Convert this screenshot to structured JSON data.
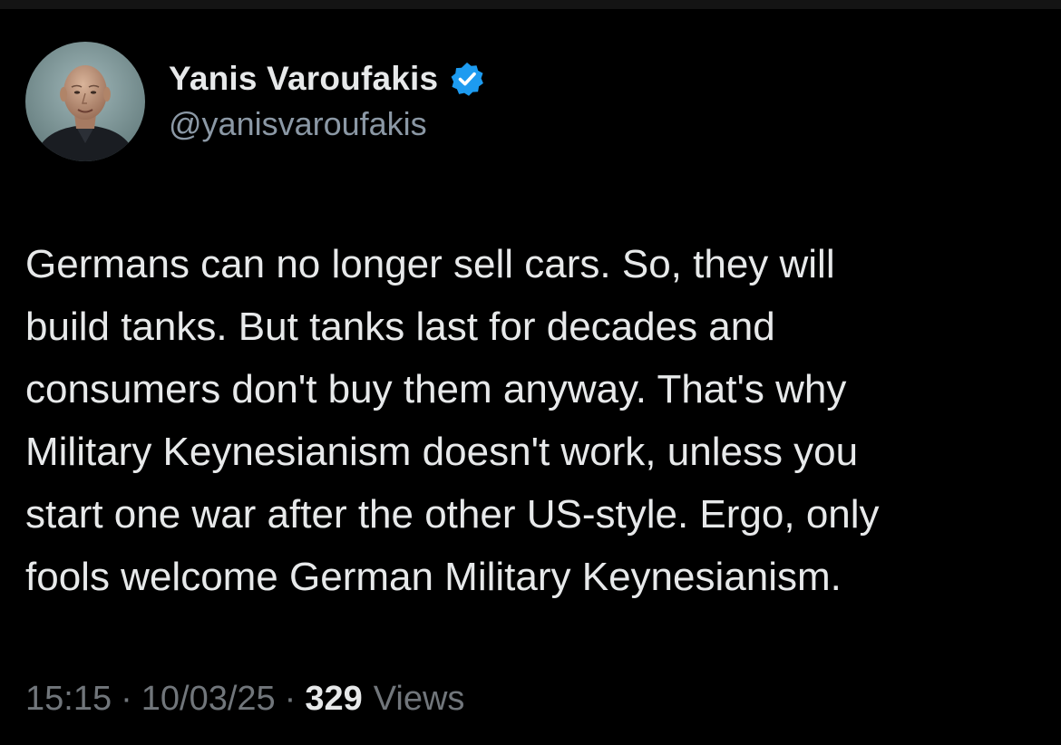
{
  "author": {
    "display_name": "Yanis Varoufakis",
    "handle": "@yanisvaroufakis",
    "verified": true,
    "badge_color": "#1d9bf0"
  },
  "tweet": {
    "text": "Germans can no longer sell cars. So, they will\nbuild tanks. But tanks last for decades and\nconsumers don't buy them anyway. That's why\nMilitary Keynesianism doesn't work, unless you\nstart one war after the other US-style. Ergo, only\nfools welcome German Military Keynesianism."
  },
  "meta": {
    "time": "15:15",
    "separator": "·",
    "date": "10/03/25",
    "view_count": "329",
    "views_label": "Views"
  },
  "theme": {
    "background": "#000000",
    "text_primary": "#e7e9ea",
    "text_secondary": "#71767b"
  }
}
